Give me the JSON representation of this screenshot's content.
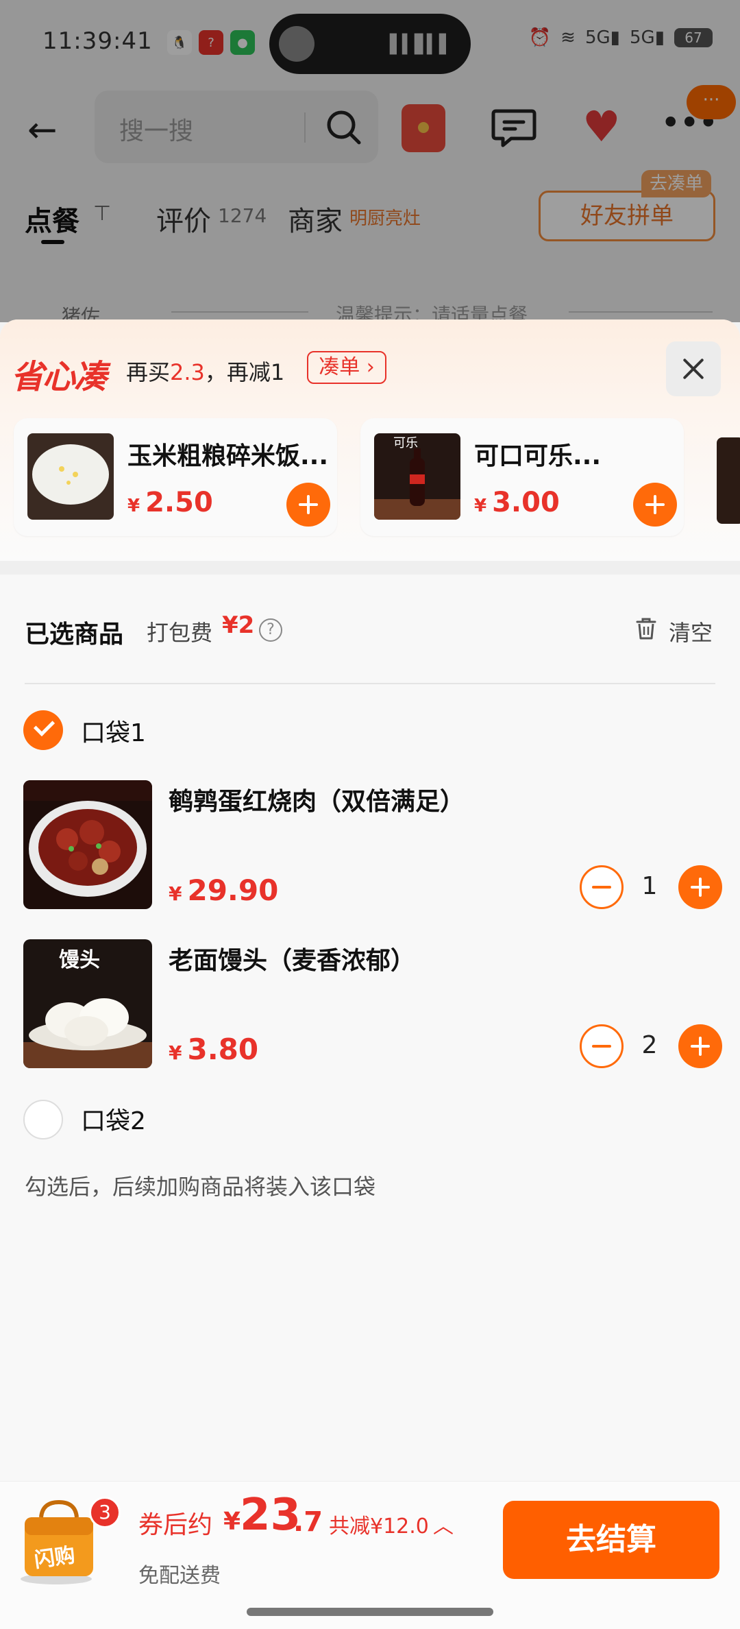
{
  "status_bar": {
    "time": "11:39:41",
    "battery": "67",
    "net1": "5G",
    "net2": "5G"
  },
  "search": {
    "placeholder": "搜一搜"
  },
  "tabs": {
    "order": "点餐",
    "review": "评价",
    "review_count": "1274",
    "merchant": "商家",
    "merchant_badge": "明厨亮灶",
    "friend_group": "好友拼单",
    "go_combine": "去凑单"
  },
  "background_peek": {
    "text": "猪佐",
    "tip": "温馨提示：请适量点餐"
  },
  "promo": {
    "logo": "省心凑",
    "text_prefix": "再买",
    "amount": "2.3",
    "text_suffix": "，再减1",
    "combine_button": "凑单",
    "items": [
      {
        "name": "玉米粗粮碎米饭...",
        "currency": "¥",
        "price": "2.50"
      },
      {
        "name": "可口可乐...",
        "currency": "¥",
        "price": "3.00"
      }
    ]
  },
  "cart": {
    "title": "已选商品",
    "pack_fee_label": "打包费",
    "pack_fee_value": "¥2",
    "clear_label": "清空",
    "bags": [
      {
        "label": "口袋1",
        "checked": true,
        "items": [
          {
            "name": "鹌鹑蛋红烧肉（双倍满足）",
            "currency": "¥",
            "price": "29.90",
            "qty": "1"
          },
          {
            "name": "老面馒头（麦香浓郁）",
            "currency": "¥",
            "price": "3.80",
            "qty": "2"
          }
        ]
      },
      {
        "label": "口袋2",
        "checked": false,
        "items": []
      }
    ],
    "bag_hint": "勾选后，后续加购商品将装入该口袋"
  },
  "bottom_bar": {
    "cart_count": "3",
    "after_coupon": "券后约",
    "currency": "¥",
    "total_int": "23",
    "total_dec": ".7",
    "saved": "共减¥12.0",
    "free_delivery": "免配送费",
    "checkout": "去结算"
  },
  "colors": {
    "accent": "#ff6a0a",
    "price_red": "#e8322a",
    "checkout": "#ff5f00"
  }
}
